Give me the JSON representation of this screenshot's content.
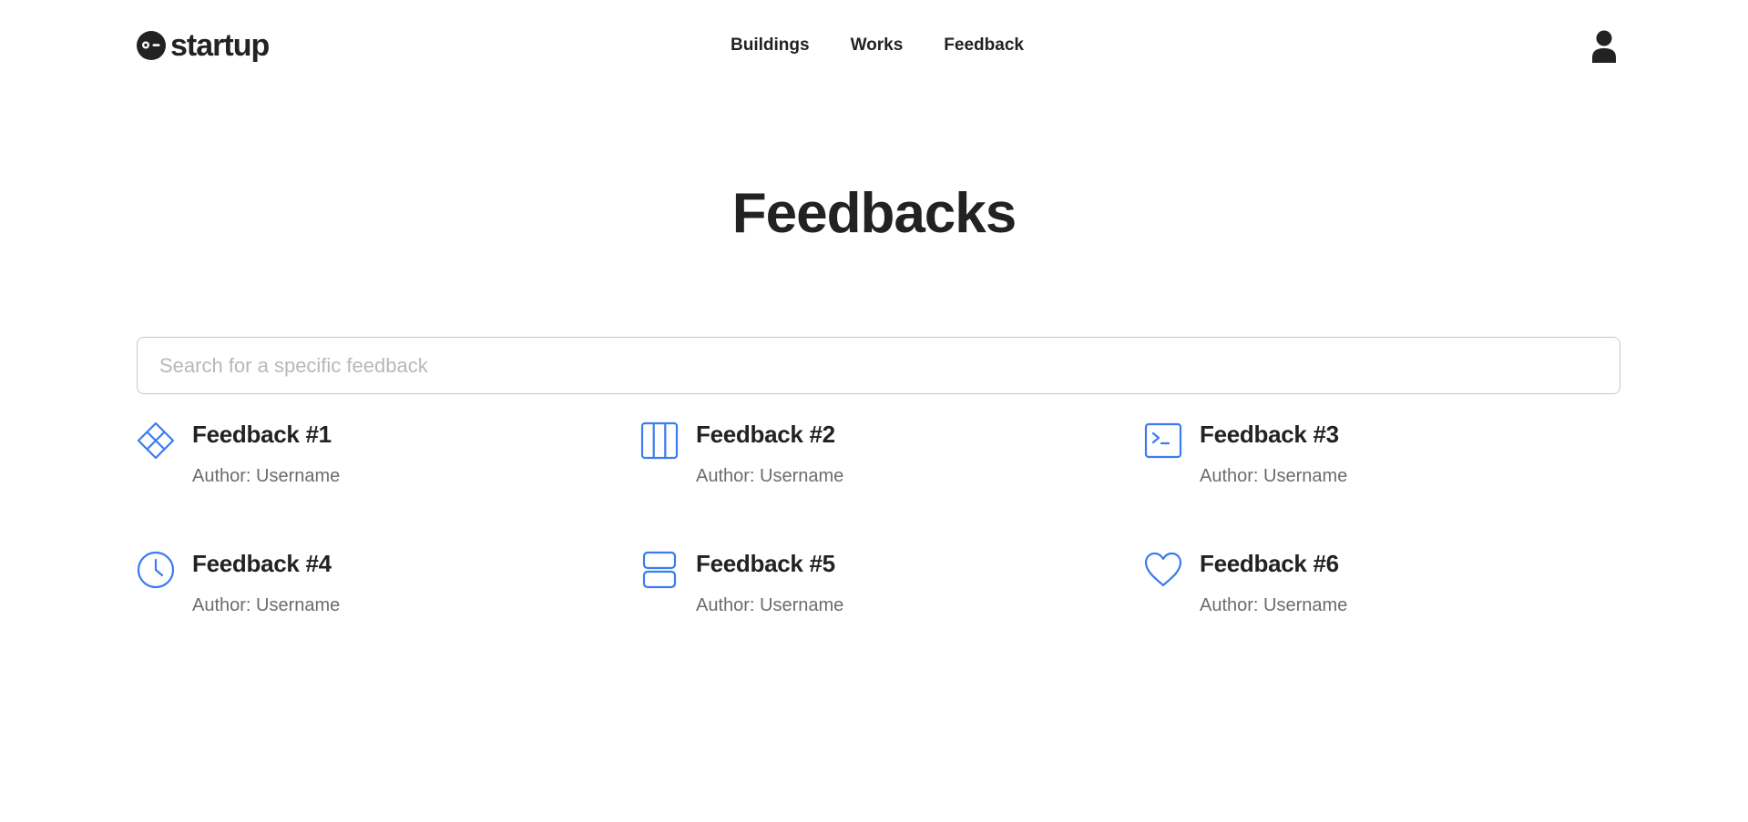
{
  "brand": {
    "name": "startup",
    "icon": "winking-face-logo-icon"
  },
  "nav": {
    "items": [
      {
        "label": "Buildings"
      },
      {
        "label": "Works"
      },
      {
        "label": "Feedback"
      }
    ]
  },
  "user": {
    "icon": "user-icon"
  },
  "page": {
    "title": "Feedbacks"
  },
  "search": {
    "placeholder": "Search for a specific feedback",
    "value": ""
  },
  "feedbacks": [
    {
      "title": "Feedback #1",
      "author": "Author: Username",
      "icon": "diamond-grid-icon"
    },
    {
      "title": "Feedback #2",
      "author": "Author: Username",
      "icon": "columns-icon"
    },
    {
      "title": "Feedback #3",
      "author": "Author: Username",
      "icon": "terminal-icon"
    },
    {
      "title": "Feedback #4",
      "author": "Author: Username",
      "icon": "clock-icon"
    },
    {
      "title": "Feedback #5",
      "author": "Author: Username",
      "icon": "rows-icon"
    },
    {
      "title": "Feedback #6",
      "author": "Author: Username",
      "icon": "heart-icon"
    }
  ],
  "colors": {
    "accent": "#3b7cf0",
    "text": "#222222",
    "muted": "#6c6c6c"
  }
}
